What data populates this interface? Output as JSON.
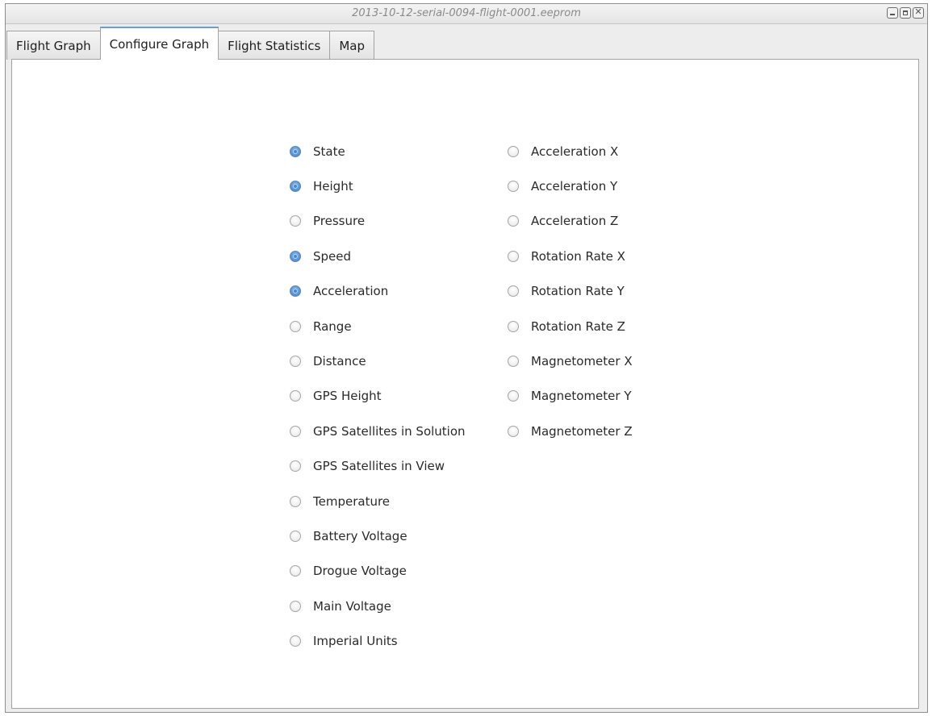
{
  "window": {
    "title": "2013-10-12-serial-0094-flight-0001.eeprom"
  },
  "tabs": [
    {
      "label": "Flight Graph",
      "active": false
    },
    {
      "label": "Configure Graph",
      "active": true
    },
    {
      "label": "Flight Statistics",
      "active": false
    },
    {
      "label": "Map",
      "active": false
    }
  ],
  "options_left": [
    {
      "label": "State",
      "checked": true
    },
    {
      "label": "Height",
      "checked": true
    },
    {
      "label": "Pressure",
      "checked": false
    },
    {
      "label": "Speed",
      "checked": true
    },
    {
      "label": "Acceleration",
      "checked": true
    },
    {
      "label": "Range",
      "checked": false
    },
    {
      "label": "Distance",
      "checked": false
    },
    {
      "label": "GPS Height",
      "checked": false
    },
    {
      "label": "GPS Satellites in Solution",
      "checked": false
    },
    {
      "label": "GPS Satellites in View",
      "checked": false
    },
    {
      "label": "Temperature",
      "checked": false
    },
    {
      "label": "Battery Voltage",
      "checked": false
    },
    {
      "label": "Drogue Voltage",
      "checked": false
    },
    {
      "label": "Main Voltage",
      "checked": false
    },
    {
      "label": "Imperial Units",
      "checked": false
    }
  ],
  "options_right": [
    {
      "label": "Acceleration X",
      "checked": false
    },
    {
      "label": "Acceleration Y",
      "checked": false
    },
    {
      "label": "Acceleration Z",
      "checked": false
    },
    {
      "label": "Rotation Rate X",
      "checked": false
    },
    {
      "label": "Rotation Rate Y",
      "checked": false
    },
    {
      "label": "Rotation Rate Z",
      "checked": false
    },
    {
      "label": "Magnetometer X",
      "checked": false
    },
    {
      "label": "Magnetometer Y",
      "checked": false
    },
    {
      "label": "Magnetometer Z",
      "checked": false
    }
  ],
  "colors": {
    "accent": "#5c97d8",
    "active_tab_border": "#6a9fd6"
  }
}
